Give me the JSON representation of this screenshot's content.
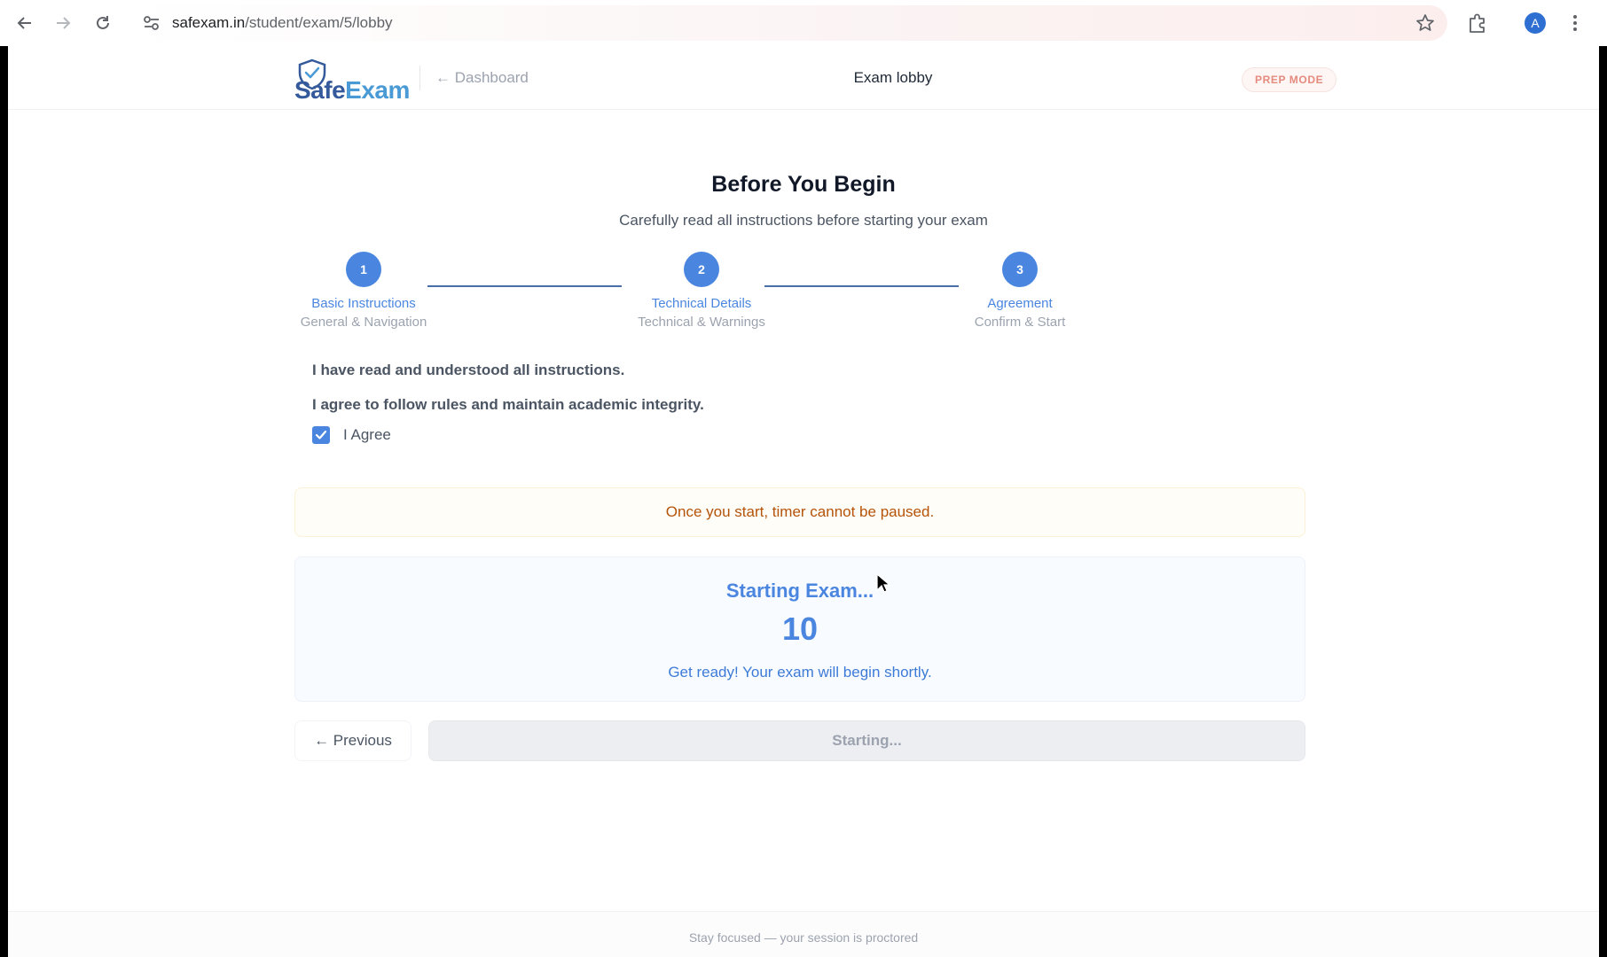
{
  "browser": {
    "url_domain": "safexam.in",
    "url_path": "/student/exam/5/lobby",
    "profile_initial": "A"
  },
  "header": {
    "logo_safe": "Safe",
    "logo_exam": "Exam",
    "back_link": "← Dashboard",
    "title": "Exam lobby",
    "mode_badge": "PREP MODE"
  },
  "main": {
    "title": "Before You Begin",
    "subtitle": "Carefully read all instructions before starting your exam"
  },
  "steps": [
    {
      "number": "1",
      "label": "Basic Instructions",
      "sub": "General & Navigation"
    },
    {
      "number": "2",
      "label": "Technical Details",
      "sub": "Technical & Warnings"
    },
    {
      "number": "3",
      "label": "Agreement",
      "sub": "Confirm & Start"
    }
  ],
  "agreement": {
    "statement_1": "I have read and understood all instructions.",
    "statement_2": "I agree to follow rules and maintain academic integrity.",
    "checkbox_label": "I Agree",
    "checked": true
  },
  "warning": "Once you start, timer cannot be paused.",
  "countdown": {
    "title": "Starting Exam...",
    "count": "10",
    "message": "Get ready! Your exam will begin shortly."
  },
  "actions": {
    "previous": "← Previous",
    "start": "Starting..."
  },
  "footer": "Stay focused — your session is proctored",
  "colors": {
    "accent": "#4a86e0",
    "warning_text": "#b45309",
    "badge_text": "#e48b7d"
  }
}
